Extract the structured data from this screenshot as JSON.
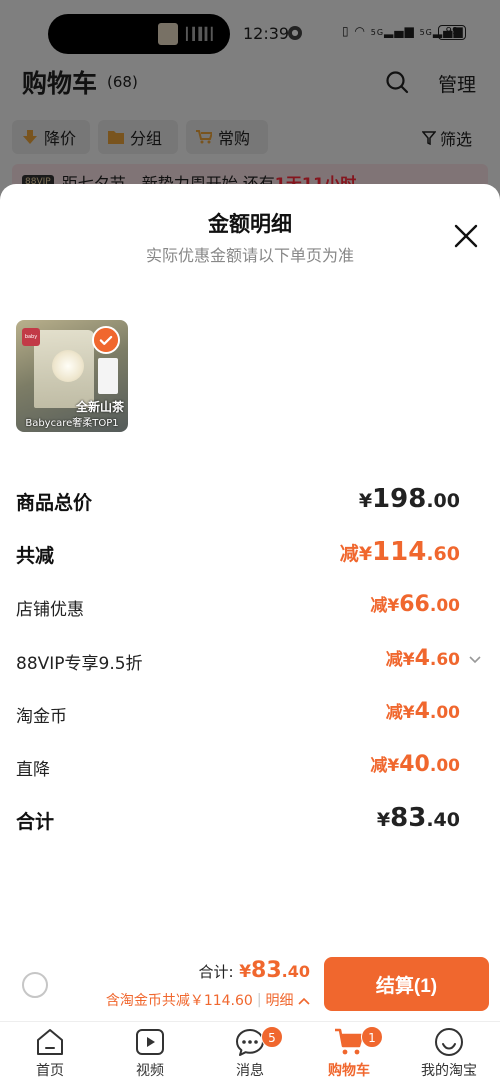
{
  "status_bar": {
    "time": "12:39",
    "signal1": "5G",
    "signal2": "5G",
    "battery": "99"
  },
  "header": {
    "title": "购物车",
    "count": "(68)",
    "manage_label": "管理"
  },
  "filters": {
    "chips": [
      {
        "label": "降价",
        "icon": "arrow-down-icon"
      },
      {
        "label": "分组",
        "icon": "folder-icon"
      },
      {
        "label": "常购",
        "icon": "cart-icon"
      }
    ],
    "filter_label": "筛选"
  },
  "banner": {
    "tag": "88VIP",
    "text": "距七夕节，新势力周开始,还有",
    "highlight": "1天11小时"
  },
  "sheet": {
    "title": "金额明细",
    "subtitle": "实际优惠金额请以下单页为准",
    "product": {
      "caption_line1": "全新山茶",
      "caption_line2": "Babycare奢柔TOP1",
      "selected": true
    },
    "rows": [
      {
        "label": "商品总价",
        "prefix": "",
        "yen": "¥",
        "int": "198",
        "dec": ".00"
      },
      {
        "label": "共减",
        "prefix": "减",
        "yen": "¥",
        "int": "114",
        "dec": ".60"
      },
      {
        "label": "店铺优惠",
        "prefix": "减",
        "yen": "¥",
        "int": "66",
        "dec": ".00"
      },
      {
        "label": "88VIP专享9.5折",
        "prefix": "减",
        "yen": "¥",
        "int": "4",
        "dec": ".60"
      },
      {
        "label": "淘金币",
        "prefix": "减",
        "yen": "¥",
        "int": "4",
        "dec": ".00"
      },
      {
        "label": "直降",
        "prefix": "减",
        "yen": "¥",
        "int": "40",
        "dec": ".00"
      },
      {
        "label": "合计",
        "prefix": "",
        "yen": "¥",
        "int": "83",
        "dec": ".40"
      }
    ]
  },
  "checkout": {
    "total_label": "合计:",
    "total_yen": "¥",
    "total_int": "83",
    "total_dec": ".40",
    "coin_text": "含淘金币共减￥114.60",
    "sep": "|",
    "detail_label": "明细",
    "pay_label": "结算(1)"
  },
  "tabbar": {
    "tabs": [
      {
        "label": "首页"
      },
      {
        "label": "视频"
      },
      {
        "label": "消息",
        "badge": "5"
      },
      {
        "label": "购物车",
        "badge": "1",
        "active": true
      },
      {
        "label": "我的淘宝"
      }
    ]
  },
  "colors": {
    "accent": "#f0672e",
    "banner_highlight": "#ff2a3a"
  }
}
